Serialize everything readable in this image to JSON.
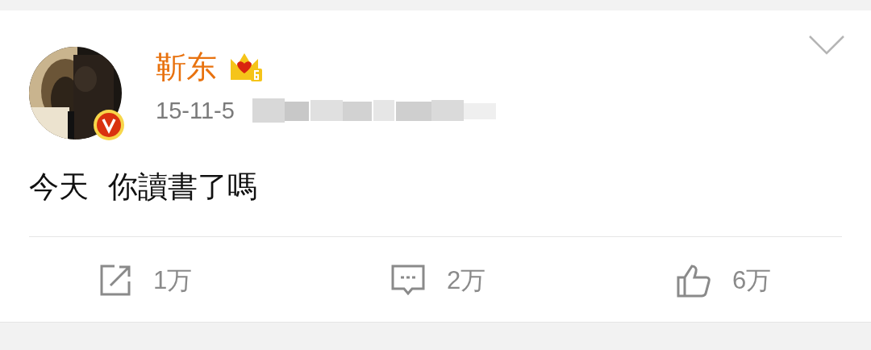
{
  "post": {
    "author": "靳东",
    "date": "15-11-5",
    "text": "今天  你讀書了嗎",
    "actions": [
      {
        "kind": "repost",
        "count": "1万"
      },
      {
        "kind": "comment",
        "count": "2万"
      },
      {
        "kind": "like",
        "count": "6万"
      }
    ]
  }
}
